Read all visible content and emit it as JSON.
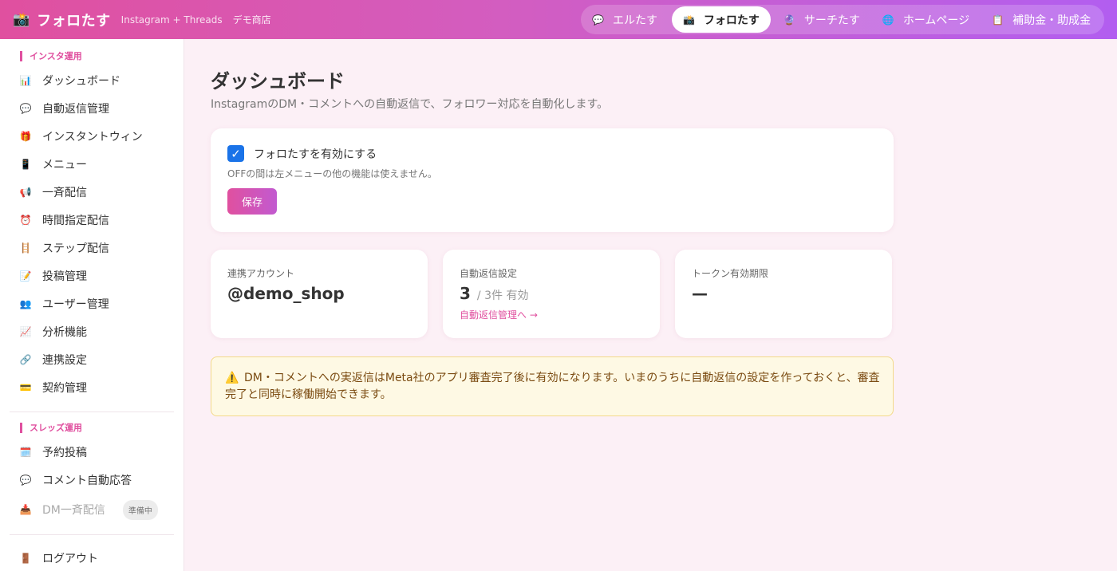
{
  "header": {
    "app_title": "フォロたす",
    "subtitle": "Instagram + Threads",
    "store": "デモ商店",
    "nav": [
      {
        "label": "エルたす",
        "icon": "speech-bubble-icon"
      },
      {
        "label": "フォロたす",
        "icon": "camera-icon",
        "active": true
      },
      {
        "label": "サーチたす",
        "icon": "crystal-ball-icon"
      },
      {
        "label": "ホームページ",
        "icon": "globe-icon"
      },
      {
        "label": "補助金・助成金",
        "icon": "clipboard-icon"
      }
    ]
  },
  "sidebar": {
    "section1": "インスタ運用",
    "items1": [
      {
        "label": "ダッシュボード",
        "icon": "bar-chart-icon"
      },
      {
        "label": "自動返信管理",
        "icon": "speech-bubble-icon"
      },
      {
        "label": "インスタントウィン",
        "icon": "gift-icon"
      },
      {
        "label": "メニュー",
        "icon": "mobile-phone-icon"
      },
      {
        "label": "一斉配信",
        "icon": "megaphone-icon"
      },
      {
        "label": "時間指定配信",
        "icon": "alarm-clock-icon"
      },
      {
        "label": "ステップ配信",
        "icon": "ladder-icon"
      },
      {
        "label": "投稿管理",
        "icon": "memo-icon"
      },
      {
        "label": "ユーザー管理",
        "icon": "users-icon"
      },
      {
        "label": "分析機能",
        "icon": "trend-chart-icon"
      },
      {
        "label": "連携設定",
        "icon": "link-icon"
      },
      {
        "label": "契約管理",
        "icon": "credit-card-icon"
      }
    ],
    "section2": "スレッズ運用",
    "items2": [
      {
        "label": "予約投稿",
        "icon": "calendar-icon"
      },
      {
        "label": "コメント自動応答",
        "icon": "speech-bubble-icon"
      },
      {
        "label": "DM一斉配信",
        "icon": "inbox-icon",
        "badge": "準備中"
      }
    ],
    "logout": {
      "label": "ログアウト",
      "icon": "door-icon"
    }
  },
  "main": {
    "title": "ダッシュボード",
    "subtitle": "InstagramのDM・コメントへの自動返信で、フォロワー対応を自動化します。",
    "enable_label": "フォロたすを有効にする",
    "enable_checked": true,
    "enable_note": "OFFの間は左メニューの他の機能は使えません。",
    "save_label": "保存",
    "stats": {
      "account_label": "連携アカウント",
      "account_value": "@demo_shop",
      "reply_label": "自動返信設定",
      "reply_count": "3",
      "reply_total": "/ 3件 有効",
      "reply_link": "自動返信管理へ →",
      "token_label": "トークン有効期限",
      "token_value": "—"
    },
    "notice": "DM・コメントへの実返信はMeta社のアプリ審査完了後に有効になります。いまのうちに自動返信の設定を作っておくと、審査完了と同時に稼働開始できます。"
  }
}
